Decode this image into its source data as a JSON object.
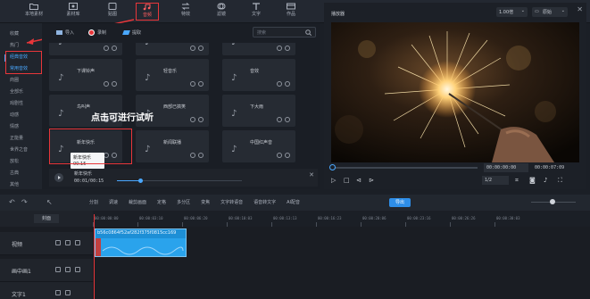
{
  "toolbar": {
    "items": [
      {
        "label": "本地素材",
        "icon": "folder-icon"
      },
      {
        "label": "素材库",
        "icon": "library-icon"
      },
      {
        "label": "贴图",
        "icon": "sticker-icon"
      },
      {
        "label": "音频",
        "icon": "music-icon",
        "active": true
      },
      {
        "label": "特效",
        "icon": "transition-icon"
      },
      {
        "label": "滤镜",
        "icon": "filter-icon"
      },
      {
        "label": "文字",
        "icon": "text-icon"
      },
      {
        "label": "作品",
        "icon": "works-icon"
      }
    ]
  },
  "categories": [
    "收藏",
    "热门",
    "经典音效",
    "常用音效",
    "商圈",
    "全部乐",
    "戏剧性",
    "动感",
    "情感",
    "正能量",
    "世界之音",
    "放松",
    "古典",
    "其他"
  ],
  "selected_categories": [
    "经典音效",
    "常用音效"
  ],
  "music_tabs": {
    "import": "导入",
    "record": "录制",
    "extract": "提取"
  },
  "search": {
    "placeholder": "搜索"
  },
  "cards": [
    {
      "name": ""
    },
    {
      "name": ""
    },
    {
      "name": ""
    },
    {
      "name": "下课铃声"
    },
    {
      "name": "轻音乐"
    },
    {
      "name": "音效"
    },
    {
      "name": "鸟叫声"
    },
    {
      "name": "西部已搞笑"
    },
    {
      "name": "下大雨"
    },
    {
      "name": "新年快乐"
    },
    {
      "name": "新闻联播"
    },
    {
      "name": "中国红声音"
    }
  ],
  "tooltip": {
    "name": "新年快乐",
    "duration": "00:15"
  },
  "annotation": {
    "text": "点击可进行试听"
  },
  "player": {
    "name": "新年快乐",
    "time": "00:01/00:15"
  },
  "preview": {
    "title": "播放器",
    "speed": "1.00倍",
    "ratio": "原始",
    "current_time": "00:00:00:00",
    "total_time": "00:00:07:09",
    "page": "1/2"
  },
  "timeline_tools": [
    "撤销",
    "分割",
    "调速",
    "裁剪画面",
    "定格",
    "多分区",
    "变焦",
    "文字转语音",
    "语音转文字",
    "AI配音",
    "导出"
  ],
  "ruler_ticks": [
    "00:00:00:00",
    "00:00:03:10",
    "00:00:06:20",
    "00:00:10:03",
    "00:00:13:13",
    "00:00:16:23",
    "00:00:20:06",
    "00:00:23:16",
    "00:00:26:26",
    "00:00:30:03"
  ],
  "cover_label": "封面",
  "tracks": [
    {
      "label": "视频"
    },
    {
      "label": "画中画1"
    },
    {
      "label": "文字1"
    }
  ],
  "clip": {
    "id": "b56c0864f52af282f375f0815cc169"
  },
  "colors": {
    "accent": "#4aa8ff",
    "highlight": "#e8363a",
    "clip": "#1d8fd6"
  }
}
